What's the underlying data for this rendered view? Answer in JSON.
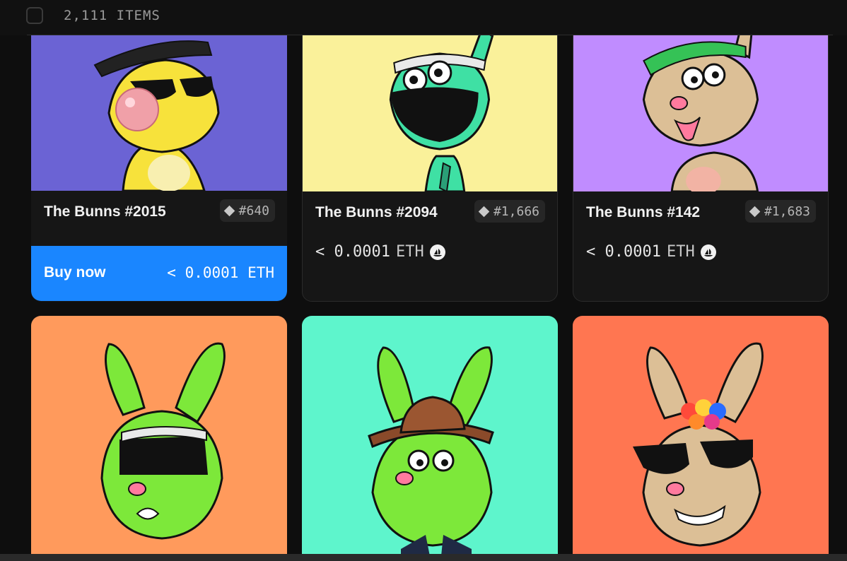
{
  "toolbar": {
    "item_count": "2,111 ITEMS"
  },
  "cards": [
    {
      "name": "The Bunns #2015",
      "rank": "#640",
      "buy_label": "Buy now",
      "price": "< 0.0001 ETH",
      "bg": "#6b63d4"
    },
    {
      "name": "The Bunns #2094",
      "rank": "#1,666",
      "price_value": "< 0.0001",
      "price_unit": "ETH",
      "bg": "#faf19a"
    },
    {
      "name": "The Bunns #142",
      "rank": "#1,683",
      "price_value": "< 0.0001",
      "price_unit": "ETH",
      "bg": "#c08cff"
    },
    {
      "bg": "#ff9a5c"
    },
    {
      "bg": "#5ef5cc"
    },
    {
      "bg": "#ff7651"
    }
  ],
  "colors": {
    "accent": "#1a86ff",
    "card_bg": "#161616",
    "page_bg": "#0e0e0e"
  }
}
